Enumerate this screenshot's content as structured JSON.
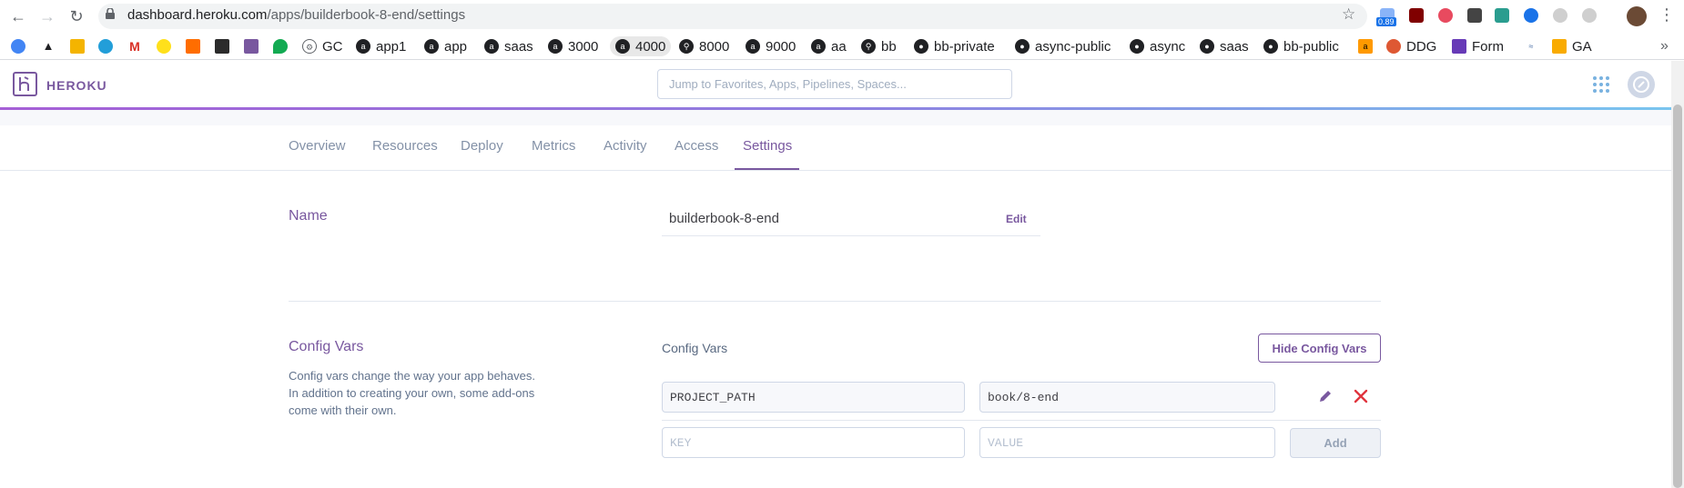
{
  "browser": {
    "url_host": "dashboard.heroku.com",
    "url_path": "/apps/builderbook-8-end/settings",
    "ext_badge": "0.89",
    "bookmarks": [
      {
        "label": "GC"
      },
      {
        "label": "app1"
      },
      {
        "label": "app"
      },
      {
        "label": "saas"
      },
      {
        "label": "3000"
      },
      {
        "label": "4000"
      },
      {
        "label": "8000"
      },
      {
        "label": "9000"
      },
      {
        "label": "aa"
      },
      {
        "label": "bb"
      },
      {
        "label": "bb-private"
      },
      {
        "label": "async-public"
      },
      {
        "label": "async"
      },
      {
        "label": "saas"
      },
      {
        "label": "bb-public"
      },
      {
        "label": "DDG"
      },
      {
        "label": "Form"
      },
      {
        "label": "GA"
      }
    ],
    "overflow": "»"
  },
  "header": {
    "logo_text": "HEROKU",
    "search_placeholder": "Jump to Favorites, Apps, Pipelines, Spaces..."
  },
  "tabs": [
    {
      "label": "Overview"
    },
    {
      "label": "Resources"
    },
    {
      "label": "Deploy"
    },
    {
      "label": "Metrics"
    },
    {
      "label": "Activity"
    },
    {
      "label": "Access"
    },
    {
      "label": "Settings",
      "active": true
    }
  ],
  "name_section": {
    "title": "Name",
    "value": "builderbook-8-end",
    "edit_label": "Edit"
  },
  "config_vars": {
    "title": "Config Vars",
    "description": "Config vars change the way your app behaves. In addition to creating your own, some add-ons come with their own.",
    "label": "Config Vars",
    "hide_button": "Hide Config Vars",
    "vars": [
      {
        "key": "PROJECT_PATH",
        "value": "book/8-end"
      }
    ],
    "new_key_placeholder": "KEY",
    "new_value_placeholder": "VALUE",
    "add_button": "Add"
  },
  "colors": {
    "brand": "#79589f",
    "delete": "#e0343d"
  }
}
